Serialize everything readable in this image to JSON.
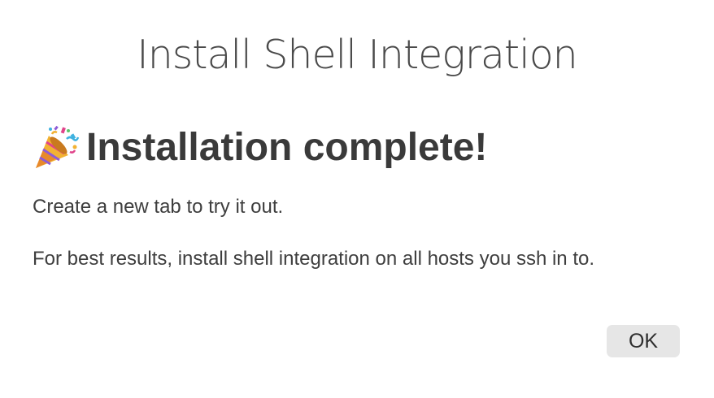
{
  "dialog": {
    "title": "Install Shell Integration",
    "headline_icon": "party-popper-icon",
    "headline": "Installation complete!",
    "message_line1": "Create a new tab to try it out.",
    "message_line2": "For best results, install shell integration on all hosts you ssh in to.",
    "ok_label": "OK"
  },
  "colors": {
    "background": "#ffffff",
    "text": "#3c3c3c",
    "button_background": "#e6e6e6"
  }
}
